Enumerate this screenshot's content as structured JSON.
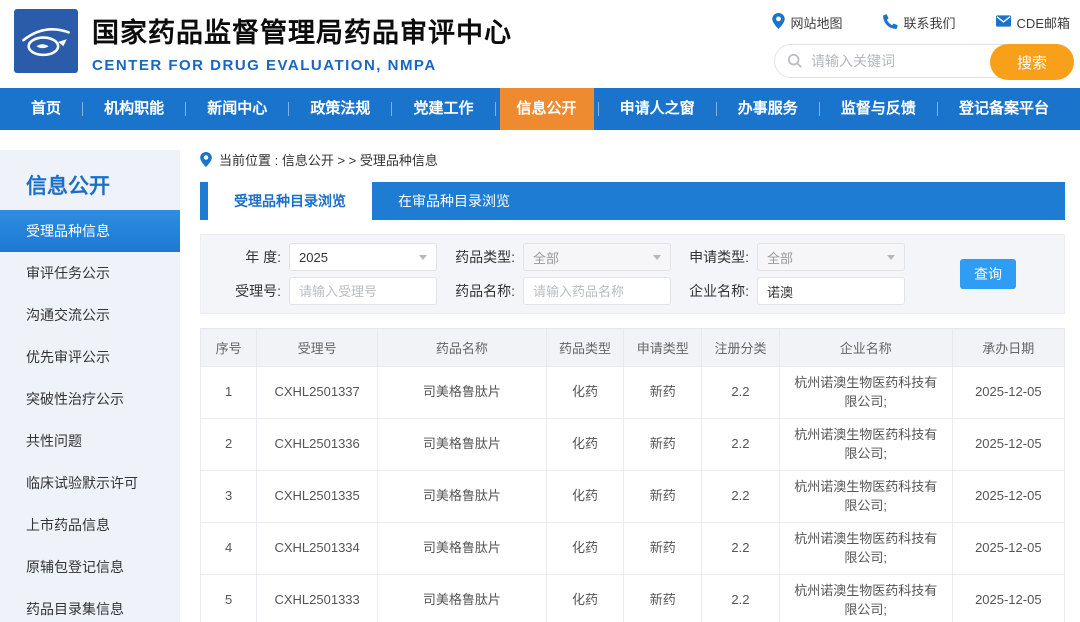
{
  "colors": {
    "brand_blue": "#1b74cc",
    "logo_blue": "#2a5caa",
    "nav_active_orange": "#ee8b31",
    "search_button_orange": "#f9a01b",
    "tab_blue": "#1e7cd3",
    "sidebar_active_blue": "#1d78d2",
    "query_button_blue": "#2e9df3"
  },
  "header": {
    "title": "国家药品监督管理局药品审评中心",
    "subtitle": "CENTER FOR DRUG EVALUATION, NMPA",
    "quick_links": [
      {
        "label": "网站地图",
        "icon": "map-pin-icon"
      },
      {
        "label": "联系我们",
        "icon": "phone-icon"
      },
      {
        "label": "CDE邮箱",
        "icon": "mail-icon"
      }
    ],
    "search": {
      "placeholder": "请输入关键词",
      "button_label": "搜索"
    }
  },
  "nav": {
    "items": [
      {
        "label": "首页",
        "active": false
      },
      {
        "label": "机构职能",
        "active": false
      },
      {
        "label": "新闻中心",
        "active": false
      },
      {
        "label": "政策法规",
        "active": false
      },
      {
        "label": "党建工作",
        "active": false
      },
      {
        "label": "信息公开",
        "active": true
      },
      {
        "label": "申请人之窗",
        "active": false
      },
      {
        "label": "办事服务",
        "active": false
      },
      {
        "label": "监督与反馈",
        "active": false
      },
      {
        "label": "登记备案平台",
        "active": false
      }
    ]
  },
  "sidebar": {
    "title": "信息公开",
    "items": [
      {
        "label": "受理品种信息",
        "active": true
      },
      {
        "label": "审评任务公示",
        "active": false
      },
      {
        "label": "沟通交流公示",
        "active": false
      },
      {
        "label": "优先审评公示",
        "active": false
      },
      {
        "label": "突破性治疗公示",
        "active": false
      },
      {
        "label": "共性问题",
        "active": false
      },
      {
        "label": "临床试验默示许可",
        "active": false
      },
      {
        "label": "上市药品信息",
        "active": false
      },
      {
        "label": "原辅包登记信息",
        "active": false
      },
      {
        "label": "药品目录集信息",
        "active": false
      }
    ]
  },
  "breadcrumb": {
    "label": "当前位置 : 信息公开 > > 受理品种信息"
  },
  "tabs": [
    {
      "label": "受理品种目录浏览",
      "active": true
    },
    {
      "label": "在审品种目录浏览",
      "active": false
    }
  ],
  "filters": {
    "year": {
      "label": "年 度:",
      "value": "2025"
    },
    "drug_type": {
      "label": "药品类型:",
      "value": "全部"
    },
    "apply_type": {
      "label": "申请类型:",
      "value": "全部"
    },
    "accept_no": {
      "label": "受理号:",
      "value": "",
      "placeholder": "请输入受理号"
    },
    "drug_name": {
      "label": "药品名称:",
      "value": "",
      "placeholder": "请输入药品名称"
    },
    "company": {
      "label": "企业名称:",
      "value": "诺澳"
    },
    "query_button": "查询"
  },
  "table": {
    "columns": [
      "序号",
      "受理号",
      "药品名称",
      "药品类型",
      "申请类型",
      "注册分类",
      "企业名称",
      "承办日期"
    ],
    "rows": [
      [
        "1",
        "CXHL2501337",
        "司美格鲁肽片",
        "化药",
        "新药",
        "2.2",
        "杭州诺澳生物医药科技有限公司;",
        "2025-12-05"
      ],
      [
        "2",
        "CXHL2501336",
        "司美格鲁肽片",
        "化药",
        "新药",
        "2.2",
        "杭州诺澳生物医药科技有限公司;",
        "2025-12-05"
      ],
      [
        "3",
        "CXHL2501335",
        "司美格鲁肽片",
        "化药",
        "新药",
        "2.2",
        "杭州诺澳生物医药科技有限公司;",
        "2025-12-05"
      ],
      [
        "4",
        "CXHL2501334",
        "司美格鲁肽片",
        "化药",
        "新药",
        "2.2",
        "杭州诺澳生物医药科技有限公司;",
        "2025-12-05"
      ],
      [
        "5",
        "CXHL2501333",
        "司美格鲁肽片",
        "化药",
        "新药",
        "2.2",
        "杭州诺澳生物医药科技有限公司;",
        "2025-12-05"
      ]
    ]
  }
}
